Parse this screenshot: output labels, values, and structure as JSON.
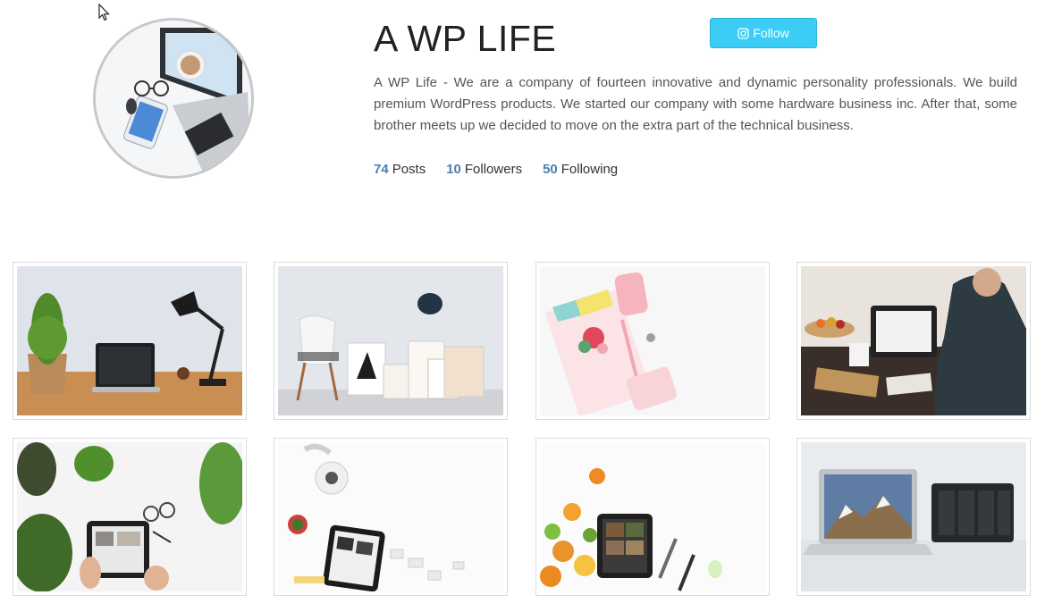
{
  "profile": {
    "name": "A WP LIFE",
    "bio": "A WP Life - We are a company of fourteen innovative and dynamic personality professionals. We build premium WordPress products. We started our company with some hardware business inc. After that, some brother meets up we decided to move on the extra part of the technical business.",
    "follow_label": "Follow"
  },
  "stats": [
    {
      "count": "74",
      "label": "Posts"
    },
    {
      "count": "10",
      "label": "Followers"
    },
    {
      "count": "50",
      "label": "Following"
    }
  ],
  "icons": {
    "follow": "instagram-icon",
    "cursor": "mouse-pointer-icon"
  },
  "colors": {
    "follow_button": "#3bcdf5",
    "stat_count": "#4a7fb0"
  },
  "gallery": [
    {
      "subject": "desk-plant-laptop-lamp"
    },
    {
      "subject": "chair-frames-hat"
    },
    {
      "subject": "notebook-flatlay"
    },
    {
      "subject": "person-tablet-table"
    },
    {
      "subject": "tablet-plants-hands"
    },
    {
      "subject": "tablet-phone-flatlay"
    },
    {
      "subject": "tablet-fruits"
    },
    {
      "subject": "laptop-nas"
    }
  ]
}
